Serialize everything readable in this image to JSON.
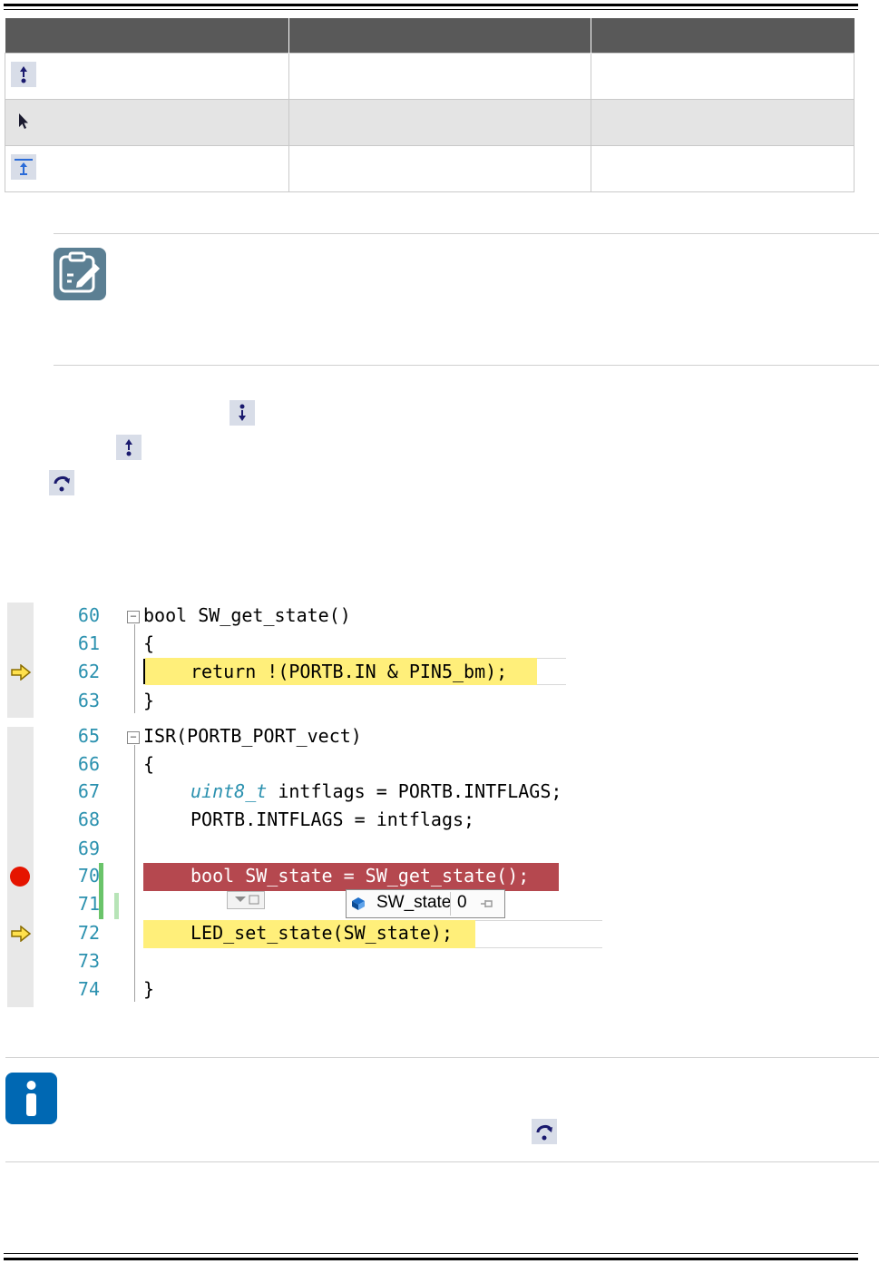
{
  "table": {
    "headers": [
      "",
      "",
      ""
    ],
    "rows": [
      {
        "icon": "step-out-icon",
        "col2": "",
        "col3": ""
      },
      {
        "icon": "run-to-cursor-icon",
        "col2": "",
        "col3": ""
      },
      {
        "icon": "reset-icon",
        "col2": "",
        "col3": ""
      }
    ]
  },
  "note_icon": "note-icon",
  "info_icon": "info-icon",
  "inline_icons": [
    "step-into-icon",
    "step-out-icon",
    "step-over-icon",
    "step-over-icon"
  ],
  "code_editor": {
    "lines_block1": [
      {
        "num": "60",
        "text": "bool SW_get_state()"
      },
      {
        "num": "61",
        "text": "{"
      },
      {
        "num": "62",
        "text": "return !(PORTB.IN & PIN5_bm);"
      },
      {
        "num": "63",
        "text": "}"
      }
    ],
    "lines_block2": [
      {
        "num": "65",
        "text": "ISR(PORTB_PORT_vect)"
      },
      {
        "num": "66",
        "text": "{"
      },
      {
        "num": "67",
        "type": "uint8_t",
        "text": " intflags = PORTB.INTFLAGS;"
      },
      {
        "num": "68",
        "text": "PORTB.INTFLAGS = intflags;"
      },
      {
        "num": "69",
        "text": ""
      },
      {
        "num": "70",
        "text": "bool SW_state = SW_get_state();"
      },
      {
        "num": "71",
        "text": ""
      },
      {
        "num": "72",
        "text": "LED_set_state(SW_state);"
      },
      {
        "num": "73",
        "text": ""
      },
      {
        "num": "74",
        "text": "}"
      }
    ],
    "datatip": {
      "name": "SW_state",
      "value": "0"
    },
    "colors": {
      "current_line": "#ffef7a",
      "breakpoint_line": "#b5484f",
      "line_number": "#2b91af"
    }
  }
}
